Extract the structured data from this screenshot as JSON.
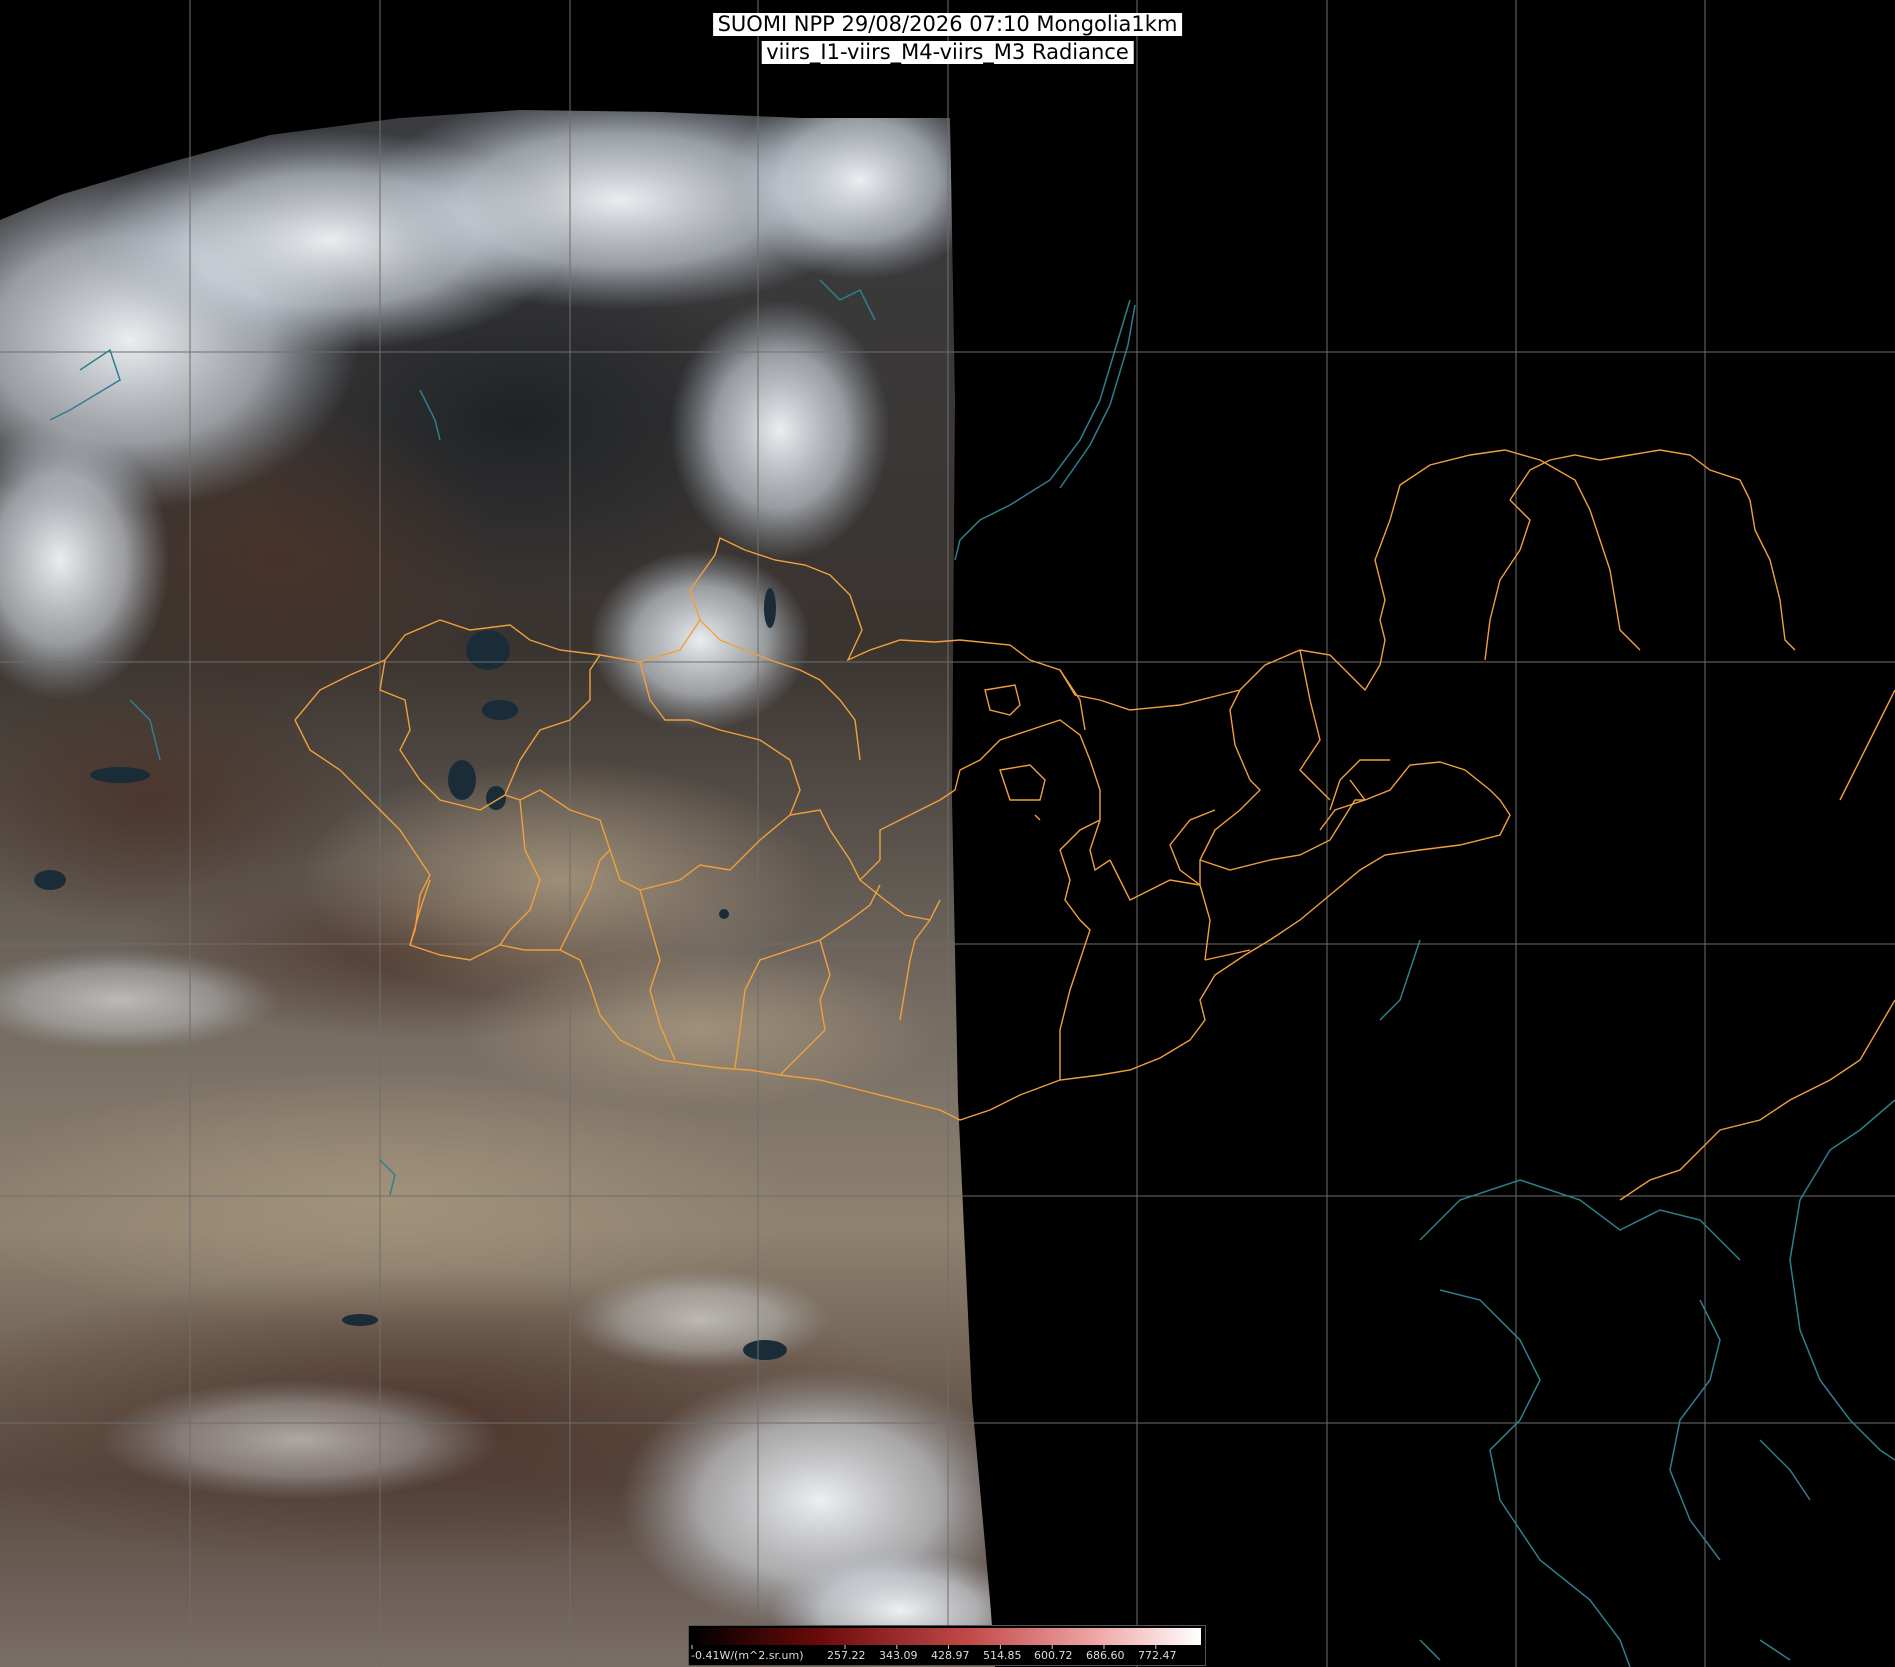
{
  "title": {
    "line1": "SUOMI NPP 29/08/2026 07:10 Mongolia1km",
    "line2": "viirs_I1-viirs_M4-viirs_M3 Radiance"
  },
  "colorbar": {
    "unit_label": "-0.41W/(m^2.sr.um)",
    "ticks": [
      "257.22",
      "343.09",
      "428.97",
      "514.85",
      "600.72",
      "686.60",
      "772.47"
    ],
    "colors": {
      "low": "#000000",
      "mid_low": "#6b0a0a",
      "mid": "#c44a4a",
      "mid_high": "#f0a8a8",
      "high": "#ffffff"
    }
  },
  "map": {
    "colors": {
      "background": "#000000",
      "graticule": "#6e6e6e",
      "province_borders": "#f0a03c",
      "coastlines": "#2e7f8e",
      "desert": "#8c8272",
      "forest": "#2f2a26",
      "cloud": "#e8eef4",
      "water": "#1e3640"
    },
    "features": [
      "graticule",
      "satellite-swath",
      "cloud-cover",
      "province-borders",
      "coastlines",
      "lakes"
    ]
  }
}
